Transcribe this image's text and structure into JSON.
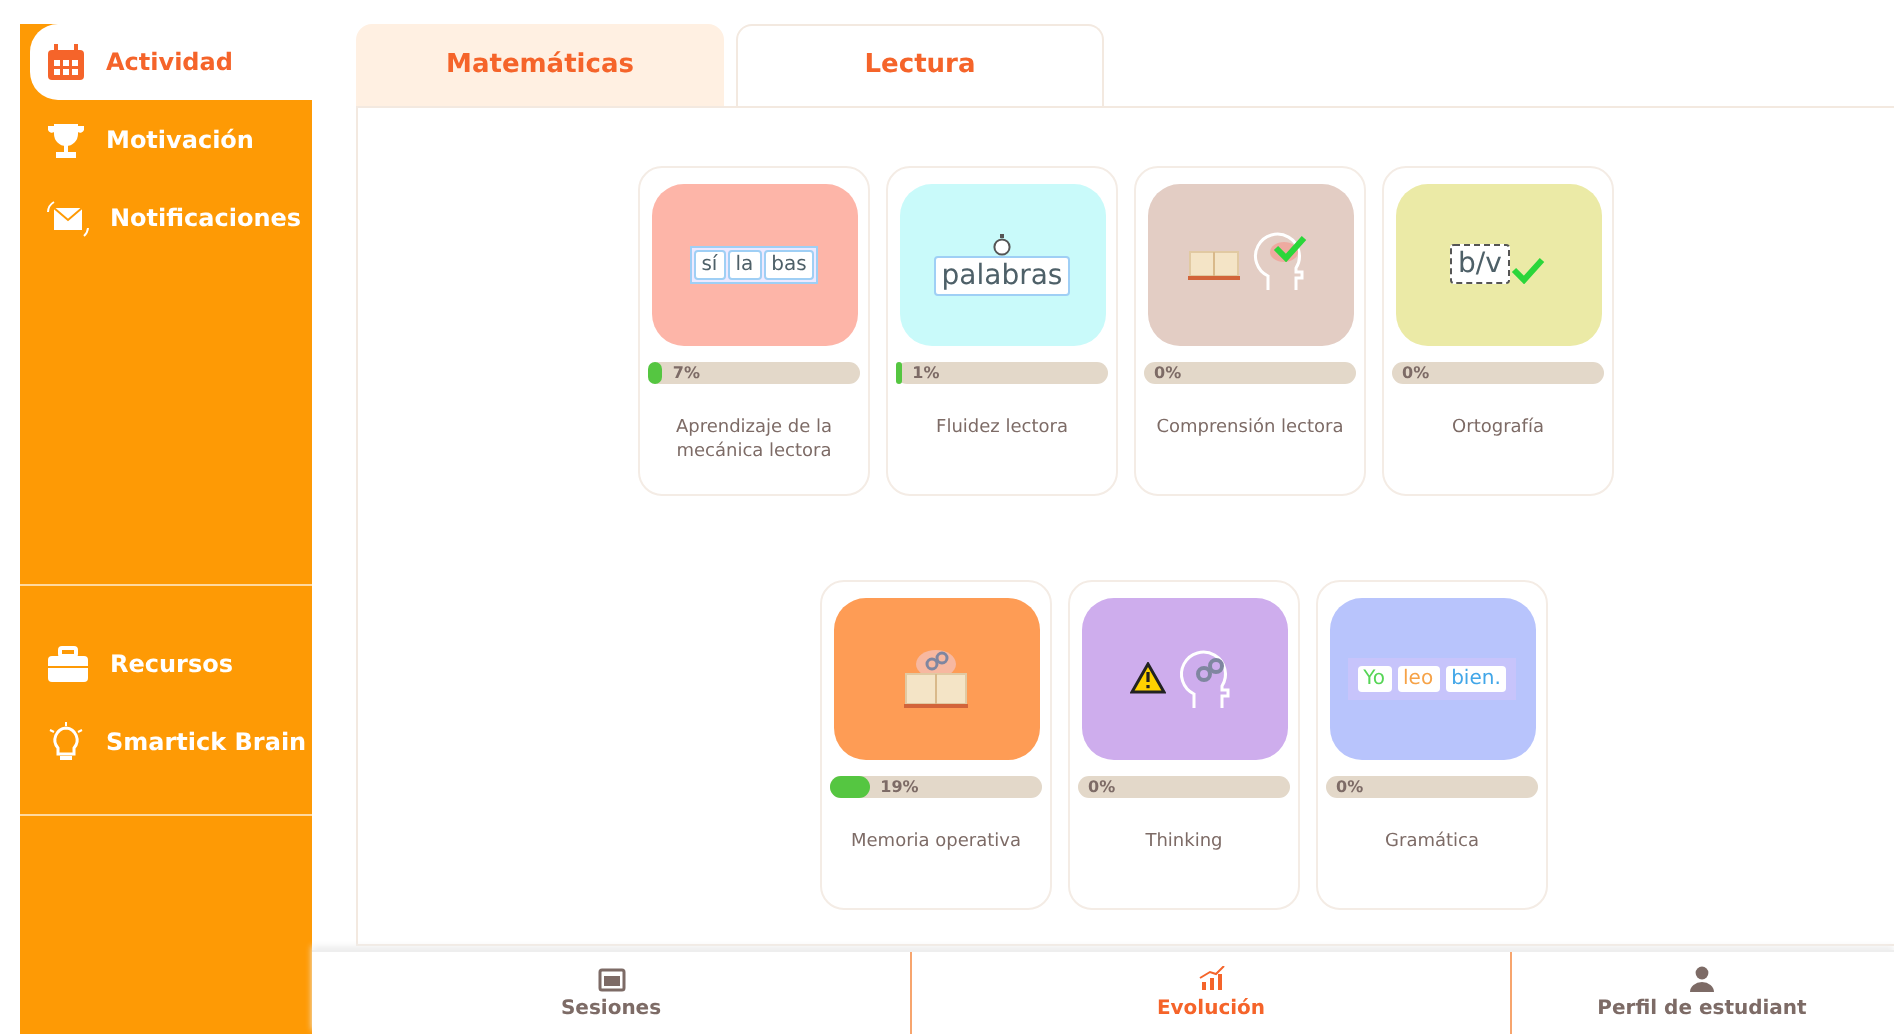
{
  "sidebar": {
    "groups": [
      {
        "items": [
          {
            "label": "Actividad",
            "selected": true
          },
          {
            "label": "Motivación",
            "selected": false
          },
          {
            "label": "Notificaciones",
            "selected": false
          }
        ]
      },
      {
        "items": [
          {
            "label": "Recursos",
            "selected": false
          },
          {
            "label": "Smartick Brain",
            "selected": false
          }
        ]
      }
    ]
  },
  "tabs": [
    {
      "label": "Matemáticas",
      "selected": false
    },
    {
      "label": "Lectura",
      "selected": true
    }
  ],
  "card_rows": [
    [
      {
        "title": "Aprendizaje de la mecánica lectora",
        "color": "#fdb5a8",
        "level": 0.07,
        "percent": "7%",
        "art": {
          "kind": "syllables",
          "words": [
            "sí",
            "la",
            "bas"
          ]
        }
      },
      {
        "title": "Fluidez lectora",
        "color": "#c9fafa",
        "level": 0.01,
        "percent": "1%",
        "art": {
          "kind": "timer",
          "words": [
            "palabras"
          ]
        }
      },
      {
        "title": "Comprensión lectora",
        "color": "#e3cdc4",
        "percent": "0%",
        "art": {
          "kind": "book-head"
        }
      },
      {
        "title": "Ortografía",
        "color": "#ebeaa6",
        "percent": "0%",
        "art": {
          "kind": "spelling",
          "words": [
            "b/v"
          ]
        }
      }
    ],
    [
      {
        "title": "Memoria operativa",
        "color": "#fe9c55",
        "level": 0.19,
        "percent": "19%",
        "art": {
          "kind": "memory"
        }
      },
      {
        "title": "Thinking",
        "color": "#ceaded",
        "percent": "0%",
        "art": {
          "kind": "thinking"
        }
      },
      {
        "title": "Gramática",
        "color": "#b8c4fc",
        "percent": "0%",
        "art": {
          "kind": "sentence",
          "words": [
            "Yo",
            "leo",
            "bien."
          ]
        }
      }
    ]
  ],
  "bottom_nav": [
    {
      "label": "Sesiones",
      "selected": false
    },
    {
      "label": "Evolución",
      "selected": true
    },
    {
      "label": "Perfil de estudiant",
      "selected": false
    }
  ]
}
